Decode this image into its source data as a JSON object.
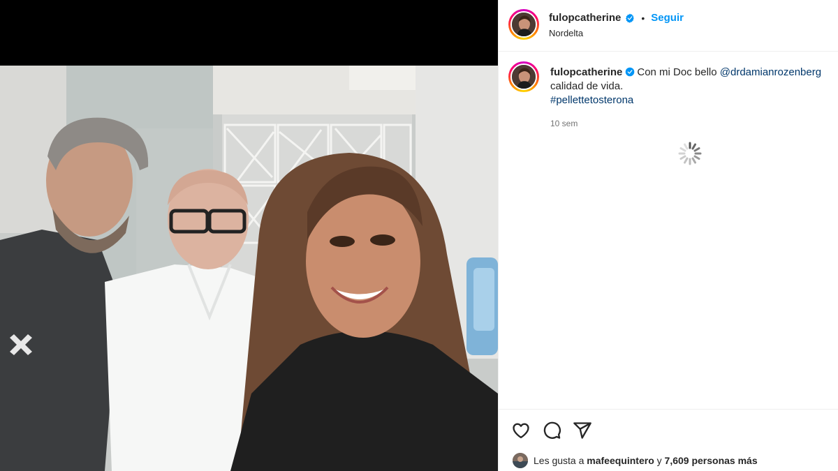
{
  "post": {
    "username": "fulopcatherine",
    "follow_label": "Seguir",
    "separator": "•",
    "location": "Nordelta"
  },
  "caption": {
    "username": "fulopcatherine",
    "text_before": "Con mi Doc bello",
    "mention": "@drdamianrozenberg",
    "text_after": "calidad de vida.",
    "hashtag": "#pellettetosterona",
    "timestamp": "10 sem"
  },
  "likes": {
    "prefix": "Les gusta a",
    "liker": "mafeequintero",
    "conjunction": "y",
    "count_text": "7,609 personas más"
  },
  "icons": {
    "verified": "verified-badge-icon",
    "like": "heart-icon",
    "comment": "comment-icon",
    "share": "share-icon",
    "loading": "loading-spinner-icon"
  },
  "colors": {
    "link_blue": "#0095f6",
    "mention_blue": "#00376b",
    "verified_blue": "#0095f6",
    "muted": "#737373"
  }
}
